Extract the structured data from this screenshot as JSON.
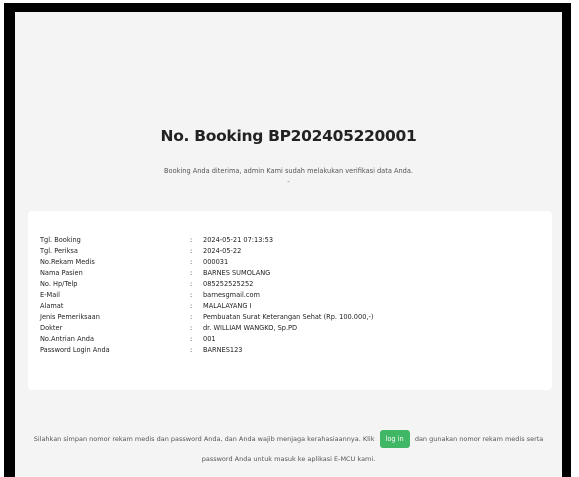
{
  "booking": {
    "title": "No. Booking BP202405220001",
    "message": "Booking Anda diterima, admin Kami sudah melakukan verifikasi data Anda.",
    "dash": "-"
  },
  "details": [
    {
      "label": "Tgl. Booking",
      "colon": ":",
      "value": "2024-05-21 07:13:53"
    },
    {
      "label": "Tgl. Periksa",
      "colon": ":",
      "value": "2024-05-22"
    },
    {
      "label": "No.Rekam Medis",
      "colon": ":",
      "value": "000031"
    },
    {
      "label": "Nama Pasien",
      "colon": ":",
      "value": "BARNES SUMOLANG"
    },
    {
      "label": "No. Hp/Telp",
      "colon": ":",
      "value": "085252525252"
    },
    {
      "label": "E-Mail",
      "colon": ":",
      "value": "barnesgmail.com"
    },
    {
      "label": "Alamat",
      "colon": ":",
      "value": "MALALAYANG I"
    },
    {
      "label": "Jenis Pemeriksaan",
      "colon": ":",
      "value": "Pembuatan Surat Keterangan Sehat (Rp. 100.000,-)"
    },
    {
      "label": "Dokter",
      "colon": ":",
      "value": "dr. WILLIAM WANGKO, Sp.PD"
    },
    {
      "label": "No.Antrian Anda",
      "colon": ":",
      "value": "001"
    },
    {
      "label": "Password Login Anda",
      "colon": ":",
      "value": "BARNES123"
    }
  ],
  "footer": {
    "text_before": "Silahkan simpan nomor rekam medis dan password Anda, dan Anda wajib menjaga kerahasiaannya. Klik",
    "login_label": "log in",
    "text_after": "dan gunakan nomor rekam medis serta",
    "line2": "password Anda untuk masuk ke aplikasi E-MCU kami."
  },
  "colors": {
    "frame": "#000000",
    "page_background": "#f4f4f4",
    "card_background": "#ffffff",
    "login_button": "#3fb765"
  }
}
